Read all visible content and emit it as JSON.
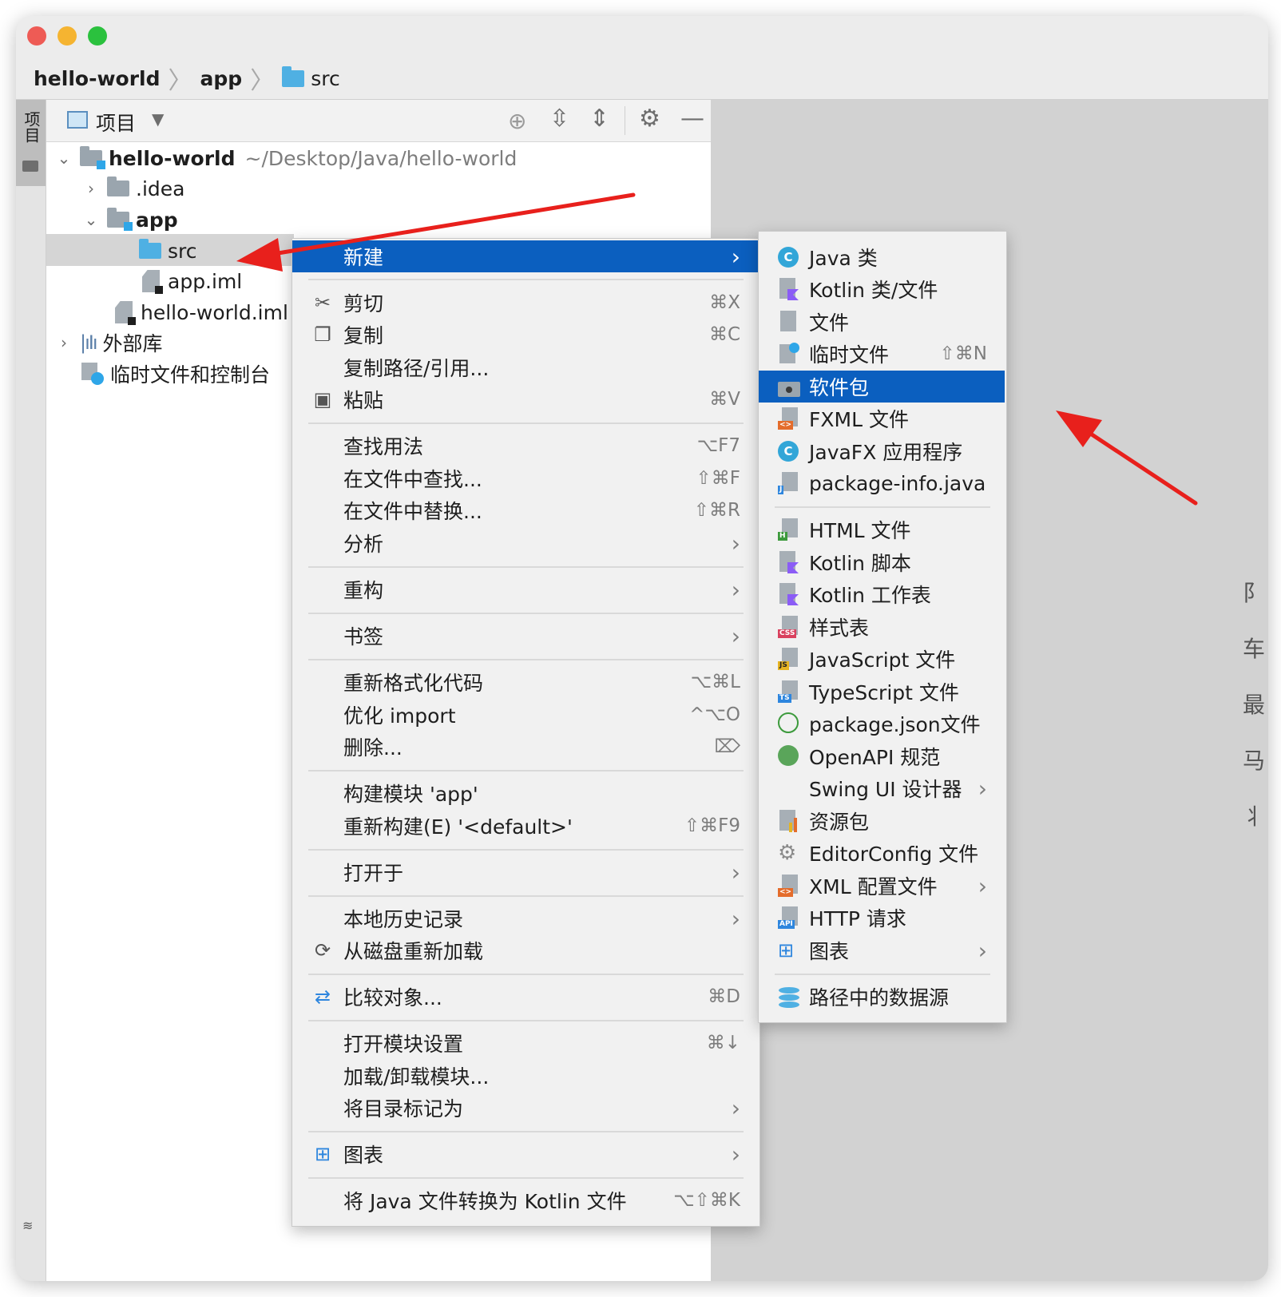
{
  "window": {
    "breadcrumb": [
      "hello-world",
      "app",
      "src"
    ],
    "traffic_lights": {
      "close": "#ee5b55",
      "minimize": "#f5b431",
      "maximize": "#2bc13e"
    }
  },
  "stripe": {
    "project_tab": "项目"
  },
  "project_panel": {
    "title": "项目",
    "tree": [
      {
        "label": "hello-world",
        "path": "~/Desktop/Java/hello-world"
      },
      {
        "label": ".idea"
      },
      {
        "label": "app"
      },
      {
        "label": "src"
      },
      {
        "label": "app.iml"
      },
      {
        "label": "hello-world.iml"
      },
      {
        "label": "外部库"
      },
      {
        "label": "临时文件和控制台"
      }
    ]
  },
  "context_menu": {
    "items": [
      {
        "label": "新建",
        "shortcut": ""
      },
      {
        "label": "剪切",
        "shortcut": "⌘X"
      },
      {
        "label": "复制",
        "shortcut": "⌘C"
      },
      {
        "label": "复制路径/引用...",
        "shortcut": ""
      },
      {
        "label": "粘贴",
        "shortcut": "⌘V"
      },
      {
        "label": "查找用法",
        "shortcut": "⌥F7"
      },
      {
        "label": "在文件中查找...",
        "shortcut": "⇧⌘F"
      },
      {
        "label": "在文件中替换...",
        "shortcut": "⇧⌘R"
      },
      {
        "label": "分析",
        "shortcut": ""
      },
      {
        "label": "重构",
        "shortcut": ""
      },
      {
        "label": "书签",
        "shortcut": ""
      },
      {
        "label": "重新格式化代码",
        "shortcut": "⌥⌘L"
      },
      {
        "label": "优化 import",
        "shortcut": "^⌥O"
      },
      {
        "label": "删除...",
        "shortcut": "⌦"
      },
      {
        "label": "构建模块 'app'",
        "shortcut": ""
      },
      {
        "label": "重新构建(E) '<default>'",
        "shortcut": "⇧⌘F9"
      },
      {
        "label": "打开于",
        "shortcut": ""
      },
      {
        "label": "本地历史记录",
        "shortcut": ""
      },
      {
        "label": "从磁盘重新加载",
        "shortcut": ""
      },
      {
        "label": "比较对象...",
        "shortcut": "⌘D"
      },
      {
        "label": "打开模块设置",
        "shortcut": "⌘↓"
      },
      {
        "label": "加载/卸载模块...",
        "shortcut": ""
      },
      {
        "label": "将目录标记为",
        "shortcut": ""
      },
      {
        "label": "图表",
        "shortcut": ""
      },
      {
        "label": "将 Java 文件转换为 Kotlin 文件",
        "shortcut": "⌥⇧⌘K"
      }
    ]
  },
  "new_submenu": {
    "items": [
      {
        "label": "Java 类",
        "shortcut": ""
      },
      {
        "label": "Kotlin 类/文件",
        "shortcut": ""
      },
      {
        "label": "文件",
        "shortcut": ""
      },
      {
        "label": "临时文件",
        "shortcut": "⇧⌘N"
      },
      {
        "label": "软件包",
        "shortcut": ""
      },
      {
        "label": "FXML 文件",
        "shortcut": ""
      },
      {
        "label": "JavaFX 应用程序",
        "shortcut": ""
      },
      {
        "label": "package-info.java",
        "shortcut": ""
      },
      {
        "label": "HTML 文件",
        "shortcut": ""
      },
      {
        "label": "Kotlin 脚本",
        "shortcut": ""
      },
      {
        "label": "Kotlin 工作表",
        "shortcut": ""
      },
      {
        "label": "样式表",
        "shortcut": ""
      },
      {
        "label": "JavaScript 文件",
        "shortcut": ""
      },
      {
        "label": "TypeScript 文件",
        "shortcut": ""
      },
      {
        "label": "package.json文件",
        "shortcut": ""
      },
      {
        "label": "OpenAPI 规范",
        "shortcut": ""
      },
      {
        "label": "Swing UI 设计器",
        "shortcut": ""
      },
      {
        "label": "资源包",
        "shortcut": ""
      },
      {
        "label": "EditorConfig 文件",
        "shortcut": ""
      },
      {
        "label": "XML 配置文件",
        "shortcut": ""
      },
      {
        "label": "HTTP 请求",
        "shortcut": ""
      },
      {
        "label": "图表",
        "shortcut": ""
      },
      {
        "label": "路径中的数据源",
        "shortcut": ""
      }
    ]
  },
  "icons": {
    "badges": {
      "html": "H",
      "css": "CSS",
      "js": "JS",
      "ts": "TS",
      "java": "C",
      "api": "API",
      "xml": "<>",
      "pkginfo": "J"
    }
  },
  "colors": {
    "selection": "#0b5fbf",
    "annotation_arrow": "#e8201c",
    "folder_blue": "#4fb0e3"
  },
  "editor_peek": [
    "阝",
    "车",
    "最",
    "马",
    "丬"
  ]
}
